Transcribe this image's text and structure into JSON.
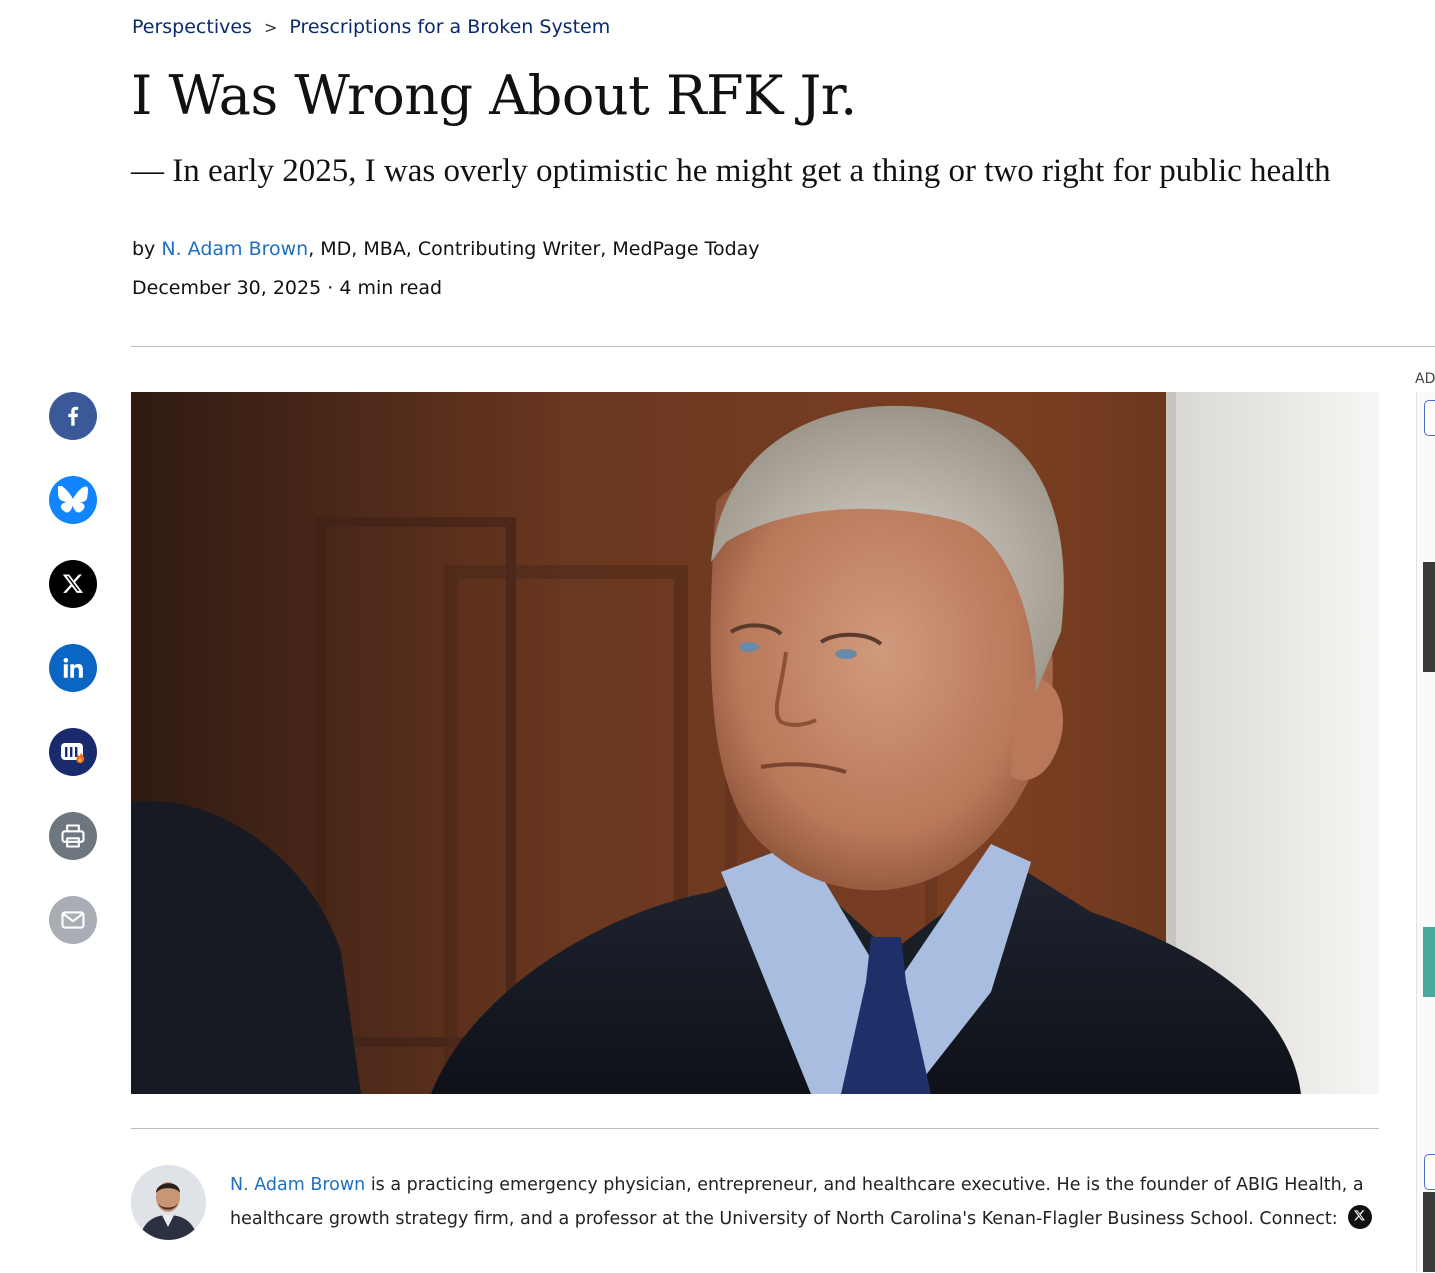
{
  "breadcrumb": {
    "section": "Perspectives",
    "separator": ">",
    "series": "Prescriptions for a Broken System"
  },
  "article": {
    "title": "I Was Wrong About RFK Jr.",
    "subtitle": "— In early 2025, I was overly optimistic he might get a thing or two right for public health",
    "byline_prefix": "by",
    "author_name": "N. Adam Brown",
    "author_credentials": ", MD, MBA, Contributing Writer, MedPage Today",
    "date": "December 30, 2025",
    "date_separator": "·",
    "read_time": "4 min read"
  },
  "share_buttons": [
    {
      "name": "facebook",
      "icon": "facebook-icon",
      "color": "#3b5998"
    },
    {
      "name": "bluesky",
      "icon": "bluesky-icon",
      "color": "#1185fe"
    },
    {
      "name": "x",
      "icon": "x-icon",
      "color": "#000000"
    },
    {
      "name": "linkedin",
      "icon": "linkedin-icon",
      "color": "#0a66c2"
    },
    {
      "name": "doximity",
      "icon": "doximity-icon",
      "color": "#1a2b6b"
    },
    {
      "name": "print",
      "icon": "print-icon",
      "color": "#6e7680"
    },
    {
      "name": "email",
      "icon": "email-icon",
      "color": "#a9aeb5"
    }
  ],
  "ad": {
    "label": "AD"
  },
  "author_bio": {
    "name": "N. Adam Brown",
    "text": " is a practicing emergency physician, entrepreneur, and healthcare executive. He is the founder of ABIG Health, a healthcare growth strategy firm, and a professor at the University of North Carolina's Kenan-Flagler Business School. Connect:",
    "connect_icon": "x-icon"
  },
  "colors": {
    "link": "#1f6fc0",
    "breadcrumb": "#0b2a6b",
    "rule": "#bdbdbd"
  }
}
